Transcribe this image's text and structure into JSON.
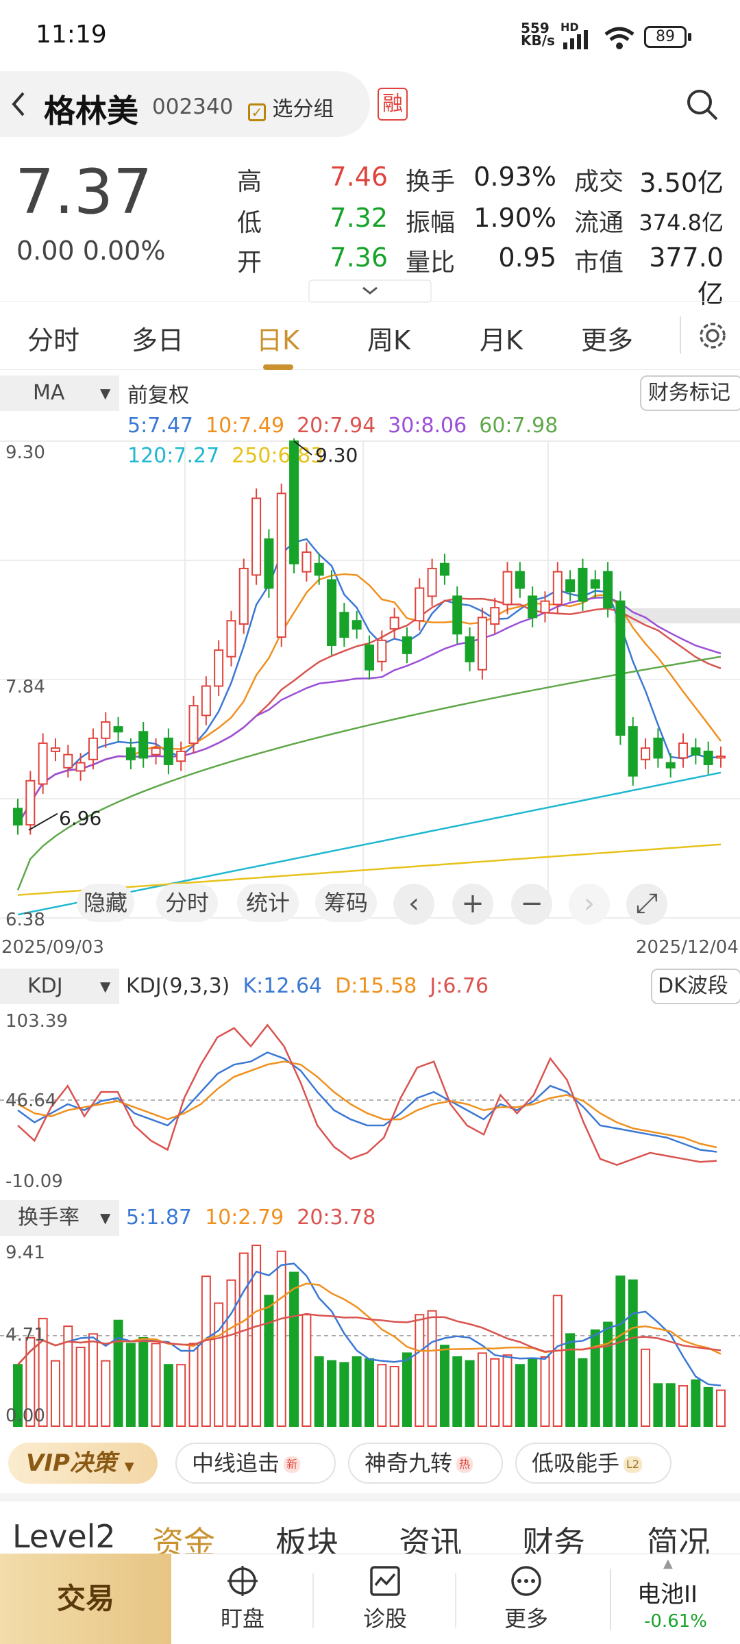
{
  "status": {
    "time": "11:19",
    "net_speed": "559",
    "net_unit": "KB/s",
    "net_tag": "HD",
    "battery": "89"
  },
  "header": {
    "name": "格林美",
    "code": "002340",
    "group": "选分组",
    "margin_tag": "融"
  },
  "quote": {
    "price": "7.37",
    "change": "0.00",
    "pct": "0.00%",
    "rows": [
      {
        "l1": "高",
        "v1": "7.46",
        "l2": "换手",
        "v2": "0.93%",
        "l3": "成交",
        "v3": "3.50亿"
      },
      {
        "l1": "低",
        "v1": "7.32",
        "l2": "振幅",
        "v2": "1.90%",
        "l3": "流通",
        "v3": "374.8亿"
      },
      {
        "l1": "开",
        "v1": "7.36",
        "l2": "量比",
        "v2": "0.95",
        "l3": "市值",
        "v3": "377.0亿"
      }
    ]
  },
  "tabs": [
    "分时",
    "多日",
    "日K",
    "周K",
    "月K",
    "更多"
  ],
  "ma": {
    "selector": "MA",
    "mode": "前复权",
    "items": [
      {
        "t": "5:7.47",
        "c": "#3a78d4"
      },
      {
        "t": "10:7.49",
        "c": "#f0901e"
      },
      {
        "t": "20:7.94",
        "c": "#d9534f"
      },
      {
        "t": "30:8.06",
        "c": "#9b4fd6"
      },
      {
        "t": "60:7.98",
        "c": "#5fa84a"
      },
      {
        "t": "120:7.27",
        "c": "#1fb8d0"
      },
      {
        "t": "250:6.83",
        "c": "#e6c21a"
      }
    ],
    "button": "财务标记"
  },
  "kline": {
    "y_top": "9.30",
    "y_mid": "7.84",
    "y_bot": "6.38",
    "hi_label": "9.30",
    "lo_label": "6.96",
    "date_start": "2025/09/03",
    "date_end": "2025/12/04"
  },
  "chips": [
    "隐藏",
    "分时",
    "统计",
    "筹码"
  ],
  "ctrls": [
    "‹",
    "+",
    "−",
    "›",
    "⤢"
  ],
  "kdj": {
    "selector": "KDJ",
    "param": "KDJ(9,3,3)",
    "k": "K:12.64",
    "d": "D:15.58",
    "j": "J:6.76",
    "button": "DK波段",
    "y_top": "103.39",
    "y_mid": "46.64",
    "y_bot": "-10.09"
  },
  "turn": {
    "selector": "换手率",
    "m5": "5:1.87",
    "m10": "10:2.79",
    "m20": "20:3.78",
    "y_top": "9.41",
    "y_mid": "4.71",
    "y_bot": "0.00"
  },
  "tools": {
    "vip": "VIP决策",
    "items": [
      "中线追击",
      "神奇九转",
      "低吸能手"
    ],
    "badges": [
      "新",
      "热",
      "L2"
    ]
  },
  "tabs2": [
    "Level2",
    "资金",
    "板块",
    "资讯",
    "财务",
    "简况"
  ],
  "bottom": {
    "trade": "交易",
    "items": [
      "盯盘",
      "诊股",
      "更多"
    ],
    "sector": "电池II",
    "sector_pct": "-0.61%"
  },
  "colors": {
    "up": "#e0433c",
    "down": "#17a32a",
    "accent": "#c9922f"
  },
  "chart_data": [
    {
      "type": "candlestick",
      "title": "",
      "xlabel": "",
      "ylabel": "",
      "x_range": [
        "2025/09/03",
        "2025/12/04"
      ],
      "ylim": [
        6.38,
        9.3
      ],
      "series": [
        {
          "name": "",
          "values": [
            {
              "o": 7.05,
              "c": 6.95
            },
            {
              "o": 6.95,
              "c": 7.22
            },
            {
              "o": 7.2,
              "c": 7.45
            },
            {
              "o": 7.4,
              "c": 7.42
            },
            {
              "o": 7.3,
              "c": 7.38
            },
            {
              "o": 7.28,
              "c": 7.33
            },
            {
              "o": 7.35,
              "c": 7.48
            },
            {
              "o": 7.48,
              "c": 7.58
            },
            {
              "o": 7.55,
              "c": 7.52
            },
            {
              "o": 7.42,
              "c": 7.35
            },
            {
              "o": 7.52,
              "c": 7.36
            },
            {
              "o": 7.38,
              "c": 7.42
            },
            {
              "o": 7.48,
              "c": 7.32
            },
            {
              "o": 7.34,
              "c": 7.4
            },
            {
              "o": 7.45,
              "c": 7.68
            },
            {
              "o": 7.62,
              "c": 7.8
            },
            {
              "o": 7.8,
              "c": 8.02
            },
            {
              "o": 7.98,
              "c": 8.2
            },
            {
              "o": 8.18,
              "c": 8.52
            },
            {
              "o": 8.48,
              "c": 8.95
            },
            {
              "o": 8.7,
              "c": 8.4
            },
            {
              "o": 8.1,
              "c": 8.98
            },
            {
              "o": 9.3,
              "c": 8.55
            },
            {
              "o": 8.5,
              "c": 8.62
            },
            {
              "o": 8.55,
              "c": 8.48
            },
            {
              "o": 8.45,
              "c": 8.05
            },
            {
              "o": 8.25,
              "c": 8.1
            },
            {
              "o": 8.2,
              "c": 8.15
            },
            {
              "o": 8.05,
              "c": 7.9
            },
            {
              "o": 7.95,
              "c": 8.08
            },
            {
              "o": 8.15,
              "c": 8.22
            },
            {
              "o": 8.1,
              "c": 8.0
            },
            {
              "o": 8.2,
              "c": 8.4
            },
            {
              "o": 8.35,
              "c": 8.52
            },
            {
              "o": 8.55,
              "c": 8.48
            },
            {
              "o": 8.35,
              "c": 8.12
            },
            {
              "o": 8.1,
              "c": 7.95
            },
            {
              "o": 7.9,
              "c": 8.22
            },
            {
              "o": 8.18,
              "c": 8.28
            },
            {
              "o": 8.3,
              "c": 8.5
            },
            {
              "o": 8.5,
              "c": 8.4
            },
            {
              "o": 8.35,
              "c": 8.22
            },
            {
              "o": 8.25,
              "c": 8.32
            },
            {
              "o": 8.3,
              "c": 8.5
            },
            {
              "o": 8.45,
              "c": 8.38
            },
            {
              "o": 8.52,
              "c": 8.32
            },
            {
              "o": 8.45,
              "c": 8.4
            },
            {
              "o": 8.5,
              "c": 8.28
            },
            {
              "o": 8.32,
              "c": 7.5
            },
            {
              "o": 7.55,
              "c": 7.25
            },
            {
              "o": 7.35,
              "c": 7.42
            },
            {
              "o": 7.48,
              "c": 7.36
            },
            {
              "o": 7.33,
              "c": 7.3
            },
            {
              "o": 7.36,
              "c": 7.45
            },
            {
              "o": 7.42,
              "c": 7.38
            },
            {
              "o": 7.4,
              "c": 7.32
            },
            {
              "o": 7.36,
              "c": 7.37
            }
          ]
        }
      ]
    },
    {
      "type": "line",
      "title": "",
      "ylim": [
        -10.09,
        103.39
      ],
      "series": [
        {
          "name": "K",
          "values": [
            40,
            32,
            38,
            44,
            40,
            46,
            48,
            38,
            34,
            30,
            40,
            52,
            64,
            70,
            72,
            78,
            74,
            66,
            52,
            40,
            34,
            30,
            30,
            38,
            48,
            52,
            46,
            40,
            34,
            44,
            40,
            46,
            56,
            52,
            42,
            30,
            28,
            26,
            24,
            22,
            18,
            14,
            12.64
          ]
        },
        {
          "name": "D",
          "values": [
            44,
            38,
            36,
            40,
            42,
            44,
            46,
            42,
            38,
            34,
            38,
            44,
            54,
            62,
            66,
            70,
            72,
            70,
            62,
            52,
            44,
            38,
            34,
            34,
            40,
            44,
            46,
            44,
            40,
            42,
            42,
            44,
            48,
            50,
            46,
            38,
            32,
            28,
            26,
            24,
            22,
            18,
            15.58
          ]
        },
        {
          "name": "J",
          "values": [
            30,
            20,
            42,
            56,
            36,
            52,
            52,
            30,
            20,
            14,
            48,
            70,
            88,
            94,
            82,
            96,
            82,
            58,
            30,
            16,
            8,
            12,
            22,
            48,
            68,
            72,
            44,
            30,
            24,
            50,
            38,
            50,
            74,
            60,
            32,
            8,
            4,
            8,
            12,
            10,
            8,
            6,
            6.76
          ]
        }
      ]
    },
    {
      "type": "bar",
      "title": "",
      "ylim": [
        0,
        9.41
      ],
      "series": [
        {
          "name": "",
          "values": [
            3.2,
            4.6,
            5.6,
            3.4,
            5.2,
            4.1,
            4.8,
            3.4,
            5.5,
            4.3,
            4.6,
            4.3,
            3.2,
            3.2,
            4.3,
            7.8,
            6.4,
            7.6,
            9.0,
            9.41,
            6.8,
            9.1,
            8.0,
            5.8,
            3.6,
            3.4,
            3.3,
            3.6,
            3.5,
            3.2,
            3.1,
            3.8,
            5.8,
            6.0,
            4.2,
            3.6,
            3.4,
            3.8,
            3.5,
            3.7,
            3.2,
            3.5,
            3.6,
            6.8,
            4.8,
            3.5,
            5.0,
            5.4,
            7.8,
            7.6,
            4.0,
            2.2,
            2.2,
            2.1,
            2.4,
            2.0,
            1.87
          ]
        }
      ]
    }
  ]
}
